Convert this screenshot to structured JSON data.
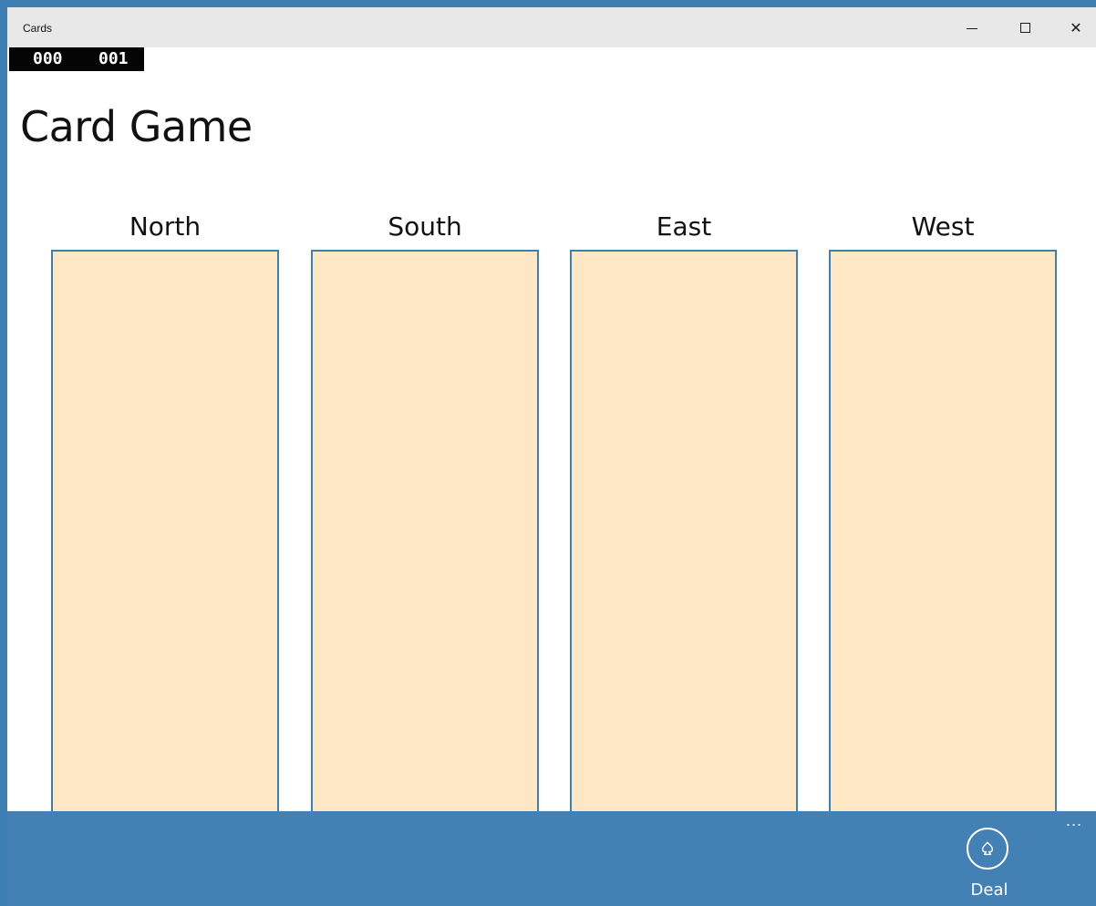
{
  "window": {
    "title": "Cards"
  },
  "counter": {
    "left": "000",
    "right": "001"
  },
  "page": {
    "title": "Card Game"
  },
  "hands": [
    {
      "label": "North"
    },
    {
      "label": "South"
    },
    {
      "label": "East"
    },
    {
      "label": "West"
    }
  ],
  "appbar": {
    "deal_label": "Deal",
    "more_label": "..."
  },
  "colors": {
    "accent": "#4381b4",
    "panel_fill": "#fde7c5",
    "panel_border": "#417ea9",
    "counter_bg": "#050505"
  }
}
